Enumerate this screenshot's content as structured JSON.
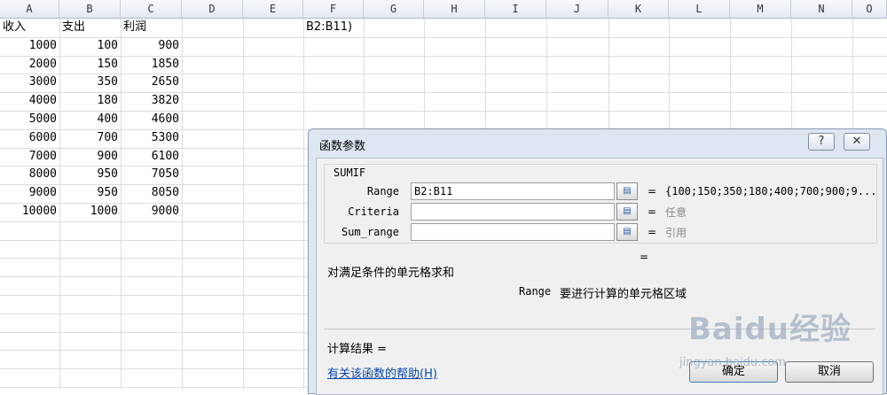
{
  "sheet": {
    "columns": [
      "A",
      "B",
      "C",
      "D",
      "E",
      "F",
      "G",
      "H",
      "I",
      "J",
      "K",
      "L",
      "M",
      "N",
      "O"
    ],
    "headers": [
      "收入",
      "支出",
      "利润"
    ],
    "rows": [
      [
        "1000",
        "100",
        "900"
      ],
      [
        "2000",
        "150",
        "1850"
      ],
      [
        "3000",
        "350",
        "2650"
      ],
      [
        "4000",
        "180",
        "3820"
      ],
      [
        "5000",
        "400",
        "4600"
      ],
      [
        "6000",
        "700",
        "5300"
      ],
      [
        "7000",
        "900",
        "6100"
      ],
      [
        "8000",
        "950",
        "7050"
      ],
      [
        "9000",
        "950",
        "8050"
      ],
      [
        "10000",
        "1000",
        "9000"
      ]
    ],
    "formula_fragment": "B2:B11)"
  },
  "dialog": {
    "title": "函数参数",
    "help_icon": "?",
    "close_icon": "✕",
    "function_name": "SUMIF",
    "params": [
      {
        "label": "Range",
        "value": "B2:B11",
        "result": "{100;150;350;180;400;700;900;9..."
      },
      {
        "label": "Criteria",
        "value": "",
        "result": "任意"
      },
      {
        "label": "Sum_range",
        "value": "",
        "result": "引用"
      }
    ],
    "equals": "=",
    "description": "对满足条件的单元格求和",
    "arg_name": "Range",
    "arg_description": "要进行计算的单元格区域",
    "calc_result": "计算结果 =",
    "help_link": "有关该函数的帮助(H)",
    "ok_label": "确定",
    "cancel_label": "取消"
  },
  "watermark": {
    "logo": "Baidu经验",
    "sub": "jingyan.baidu.com"
  },
  "colors": {
    "dialog_bg": "#dde6f1",
    "link": "#0645ad"
  }
}
